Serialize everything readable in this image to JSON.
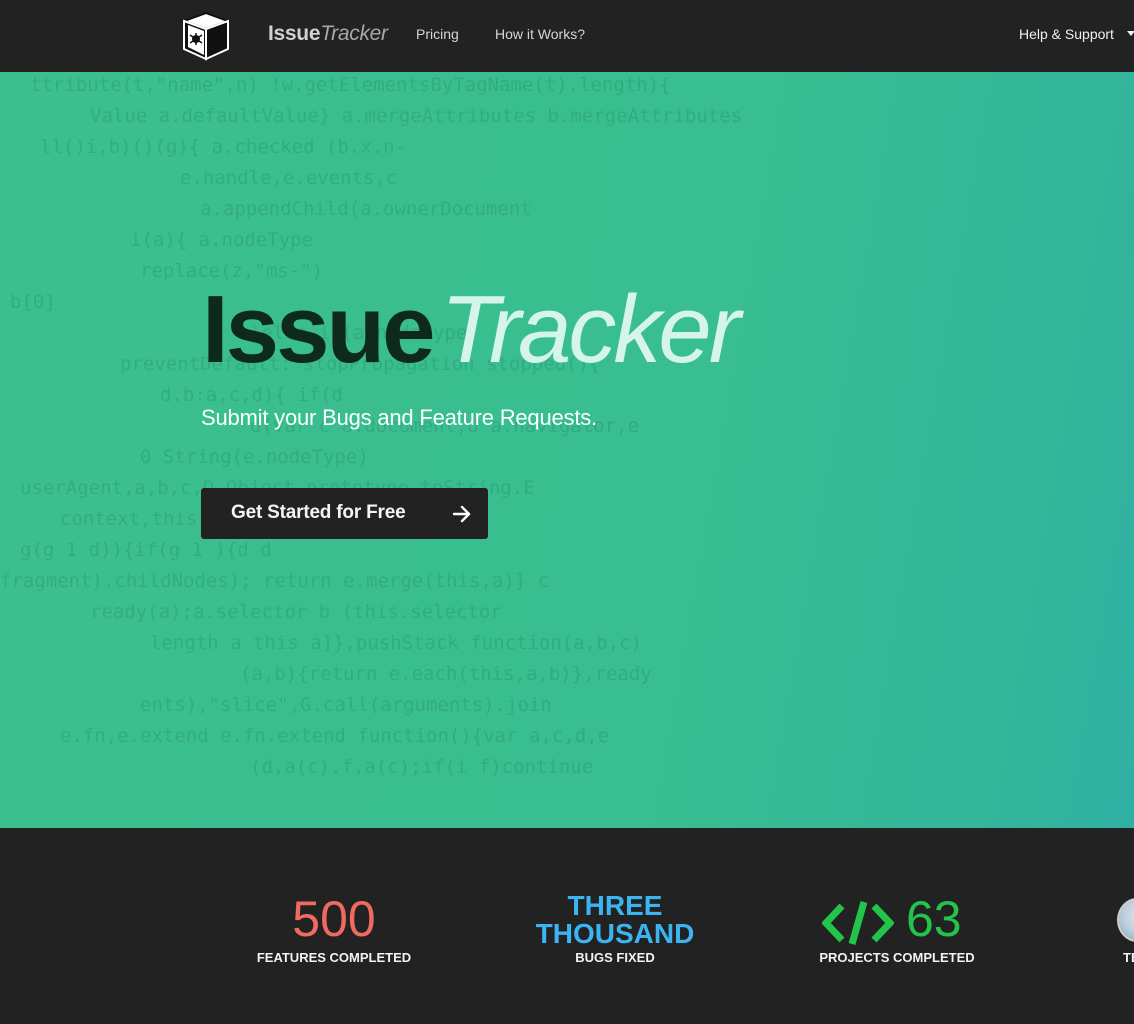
{
  "nav": {
    "brand_bold": "Issue",
    "brand_italic": "Tracker",
    "links": [
      "Pricing",
      "How it Works?"
    ],
    "help": "Help & Support",
    "logo_icon": "box-bug-icon",
    "caret_icon": "caret-down-icon"
  },
  "hero": {
    "title_bold": "Issue",
    "title_italic": "Tracker",
    "subtitle": "Submit your Bugs and Feature Requests.",
    "cta_label": "Get Started for Free",
    "cta_icon": "arrow-right-icon",
    "background_code": [
      "ttribute(t,\"name\",n) !w.getElementsByTagName(t).length){",
      "Value a.defaultValue} a.mergeAttributes b.mergeAttributes",
      "ll()i,b)()(g){ a.checked (b.x.n-",
      "e.handle,e.events,c",
      "a.appendChild(a.ownerDocument",
      "i(a){ a.nodeType",
      "replace(z,\"ms-\")",
      "b[0]",
      "}else if(a.nodeType)",
      "preventDefault: stopPropagation stopped(){",
      "d.b:a,c,d){ if(d",
      "d(var c a.document,d a.navigator,e",
      "0 String(e.nodeType)",
      "userAgent,a,b,c,D Object.prototype.toString.E",
      "context,this[0] a,this.length 1;",
      "g(g 1 d)){if(g 1 ){d d",
      "fragment).childNodes); return e.merge(this,a)} c",
      "ready(a);a.selector b (this.selector",
      "length a this a]},pushStack function(a,b,c)",
      "(a,b){return e.each(this,a,b)},ready",
      "ents),\"slice\",G.call(arguments).join",
      "e.fn,e.extend e.fn.extend function(){var a,c,d,e",
      "(d,a(c).f,a(c);if(i f)continue"
    ]
  },
  "stats": [
    {
      "value": "500",
      "label": "FEATURES COMPLETED",
      "color": "#f06a5f"
    },
    {
      "value_line1": "THREE",
      "value_line2": "THOUSAND",
      "label": "BUGS FIXED",
      "color": "#3bb4f2"
    },
    {
      "value": "63",
      "label": "PROJECTS COMPLETED",
      "color": "#22c44c",
      "icon": "code-icon"
    },
    {
      "label": "TE",
      "icon": "avatar"
    }
  ]
}
